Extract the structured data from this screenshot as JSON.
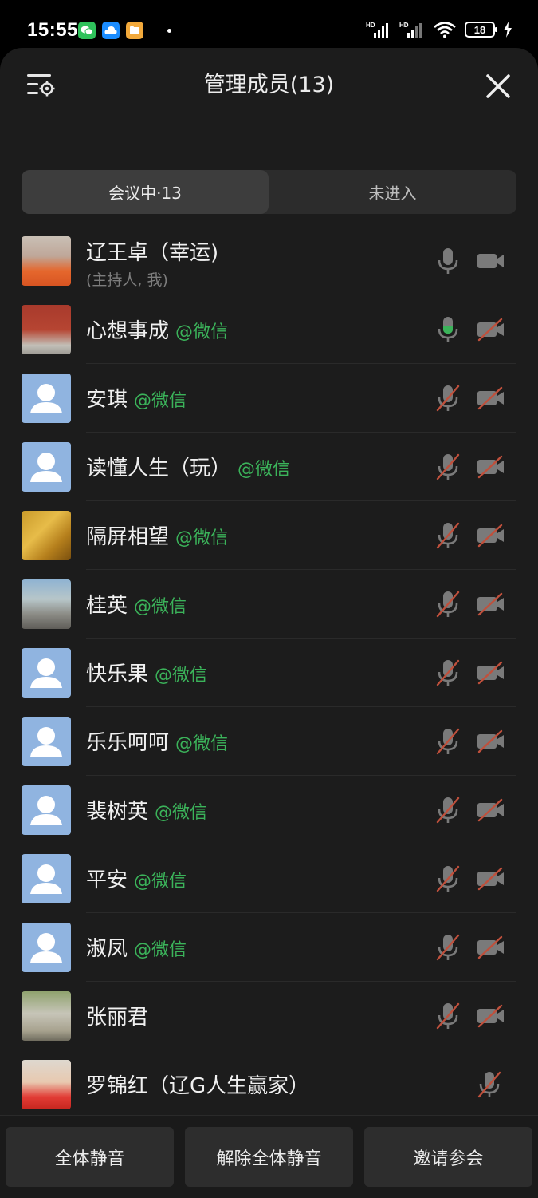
{
  "status_bar": {
    "time": "15:55",
    "battery": "18",
    "network_labels": [
      "HD",
      "HD"
    ]
  },
  "header": {
    "title": "管理成员(13)"
  },
  "tabs": [
    {
      "label": "会议中·13",
      "active": true
    },
    {
      "label": "未进入",
      "active": false
    }
  ],
  "colors": {
    "sheet_bg": "#1c1c1c",
    "wechat_tag": "#3bb35a",
    "mic_active": "#3bb35a",
    "muted_slash": "#c0503c",
    "avatar_default": "#90b4e0"
  },
  "members": [
    {
      "name": "辽王卓（幸运)",
      "tag": "",
      "sub": "(主持人, 我)",
      "mic": "on",
      "cam": "on",
      "avatar": "photo-1"
    },
    {
      "name": "心想事成",
      "tag": "@微信",
      "sub": "",
      "mic": "speaking",
      "cam": "off",
      "avatar": "photo-2"
    },
    {
      "name": "安琪",
      "tag": "@微信",
      "sub": "",
      "mic": "off",
      "cam": "off",
      "avatar": "default"
    },
    {
      "name": "读懂人生（玩）",
      "tag": "@微信",
      "sub": "",
      "mic": "off",
      "cam": "off",
      "avatar": "default"
    },
    {
      "name": "隔屏相望",
      "tag": "@微信",
      "sub": "",
      "mic": "off",
      "cam": "off",
      "avatar": "wheat"
    },
    {
      "name": "桂英",
      "tag": "@微信",
      "sub": "",
      "mic": "off",
      "cam": "off",
      "avatar": "photo-3"
    },
    {
      "name": "快乐果",
      "tag": "@微信",
      "sub": "",
      "mic": "off",
      "cam": "off",
      "avatar": "default"
    },
    {
      "name": "乐乐呵呵",
      "tag": "@微信",
      "sub": "",
      "mic": "off",
      "cam": "off",
      "avatar": "default"
    },
    {
      "name": "裴树英",
      "tag": "@微信",
      "sub": "",
      "mic": "off",
      "cam": "off",
      "avatar": "default"
    },
    {
      "name": "平安",
      "tag": "@微信",
      "sub": "",
      "mic": "off",
      "cam": "off",
      "avatar": "default"
    },
    {
      "name": "淑凤",
      "tag": "@微信",
      "sub": "",
      "mic": "off",
      "cam": "off",
      "avatar": "default"
    },
    {
      "name": "张丽君",
      "tag": "",
      "sub": "",
      "mic": "off",
      "cam": "off",
      "avatar": "photo-4"
    },
    {
      "name": "罗锦红（辽G人生赢家）",
      "tag": "",
      "sub": "",
      "mic": "off",
      "cam": "none",
      "avatar": "photo-5"
    }
  ],
  "bottom_buttons": {
    "mute_all": "全体静音",
    "unmute_all": "解除全体静音",
    "invite": "邀请参会"
  }
}
